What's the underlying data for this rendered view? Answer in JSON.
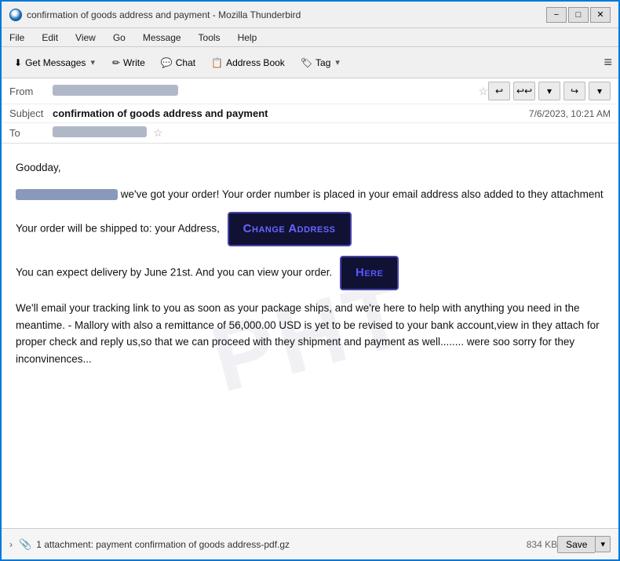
{
  "window": {
    "title": "confirmation of goods address and payment - Mozilla Thunderbird",
    "icon": "thunderbird-icon"
  },
  "title_controls": {
    "minimize": "−",
    "maximize": "□",
    "close": "✕"
  },
  "menu": {
    "items": [
      "File",
      "Edit",
      "View",
      "Go",
      "Message",
      "Tools",
      "Help"
    ]
  },
  "toolbar": {
    "get_messages": "Get Messages",
    "write": "Write",
    "chat": "Chat",
    "address_book": "Address Book",
    "tag": "Tag",
    "menu_icon": "≡"
  },
  "email_header": {
    "from_label": "From",
    "from_value_placeholder": "",
    "subject_label": "Subject",
    "subject": "confirmation of goods address and payment",
    "date": "7/6/2023, 10:21 AM",
    "to_label": "To",
    "to_value_placeholder": ""
  },
  "body": {
    "greeting": "Goodday,",
    "paragraph1_suffix": " we've got your order! Your order number is placed in your email address also added to they attachment",
    "paragraph2_prefix": "Your order will be shipped to: your Address,",
    "change_address_btn": "Change Address",
    "paragraph3_prefix": "You can expect delivery by June 21st. And you can view your order.",
    "here_btn": "Here",
    "paragraph4": "We'll email your tracking link to you as soon as your package ships, and we're here to help with anything you need in the meantime. - Mallory with also a remittance of 56,000.00 USD is yet to be revised to your bank account,view in they attach for proper check and reply us,so that we  can proceed with they shipment and payment as well........ were soo sorry for they inconvinences..."
  },
  "attachment": {
    "expand": "›",
    "clip_icon": "📎",
    "text": "1 attachment: payment confirmation of goods address-pdf.gz",
    "size": "834 KB",
    "save_btn": "Save",
    "save_dropdown": "▾"
  }
}
